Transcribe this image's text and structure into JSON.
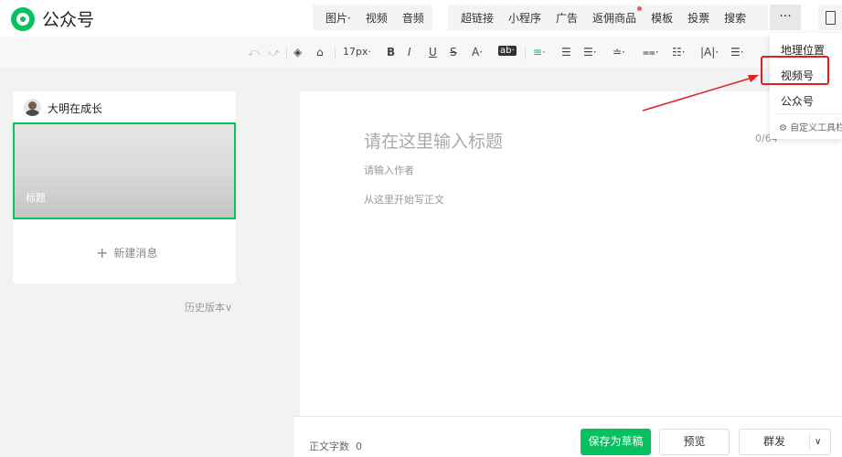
{
  "app": {
    "logo_text": "公众号"
  },
  "insert_menu": {
    "group1": [
      "图片·",
      "视频",
      "音频"
    ],
    "group2": [
      "超链接",
      "小程序",
      "广告",
      "返佣商品",
      "模板",
      "投票",
      "搜索"
    ],
    "more_label": "···"
  },
  "toolbar": {
    "undo": "⤺",
    "redo": "⤻",
    "format_painter": "◈",
    "clear_format": "⌂",
    "font_size": "17px·",
    "bold": "B",
    "italic": "I",
    "underline": "U",
    "strikethrough": "S",
    "font_color": "A·",
    "bg_color": "ab·",
    "align_left": "≡·",
    "align_opts": [
      "☰",
      "☰·",
      "≐·",
      "⩵·",
      "☷·",
      "|A|·",
      "☰·"
    ]
  },
  "sidebar": {
    "account_name": "大明在成长",
    "thumb_title": "标题",
    "new_message": "新建消息",
    "new_message_icon": "+",
    "history": "历史版本∨"
  },
  "editor": {
    "title_placeholder": "请在这里输入标题",
    "title_count": "0/64",
    "author_placeholder": "请输入作者",
    "body_placeholder": "从这里开始写正文"
  },
  "footer": {
    "word_count_label": "正文字数",
    "word_count_value": "0",
    "save_draft": "保存为草稿",
    "preview": "预览",
    "publish": "群发",
    "publish_caret": "∨"
  },
  "dropdown": {
    "items": [
      "地理位置",
      "视频号",
      "公众号"
    ],
    "custom_toolbar": "⚙ 自定义工具栏"
  },
  "colors": {
    "brand": "#07c160",
    "highlight": "#e02020"
  }
}
